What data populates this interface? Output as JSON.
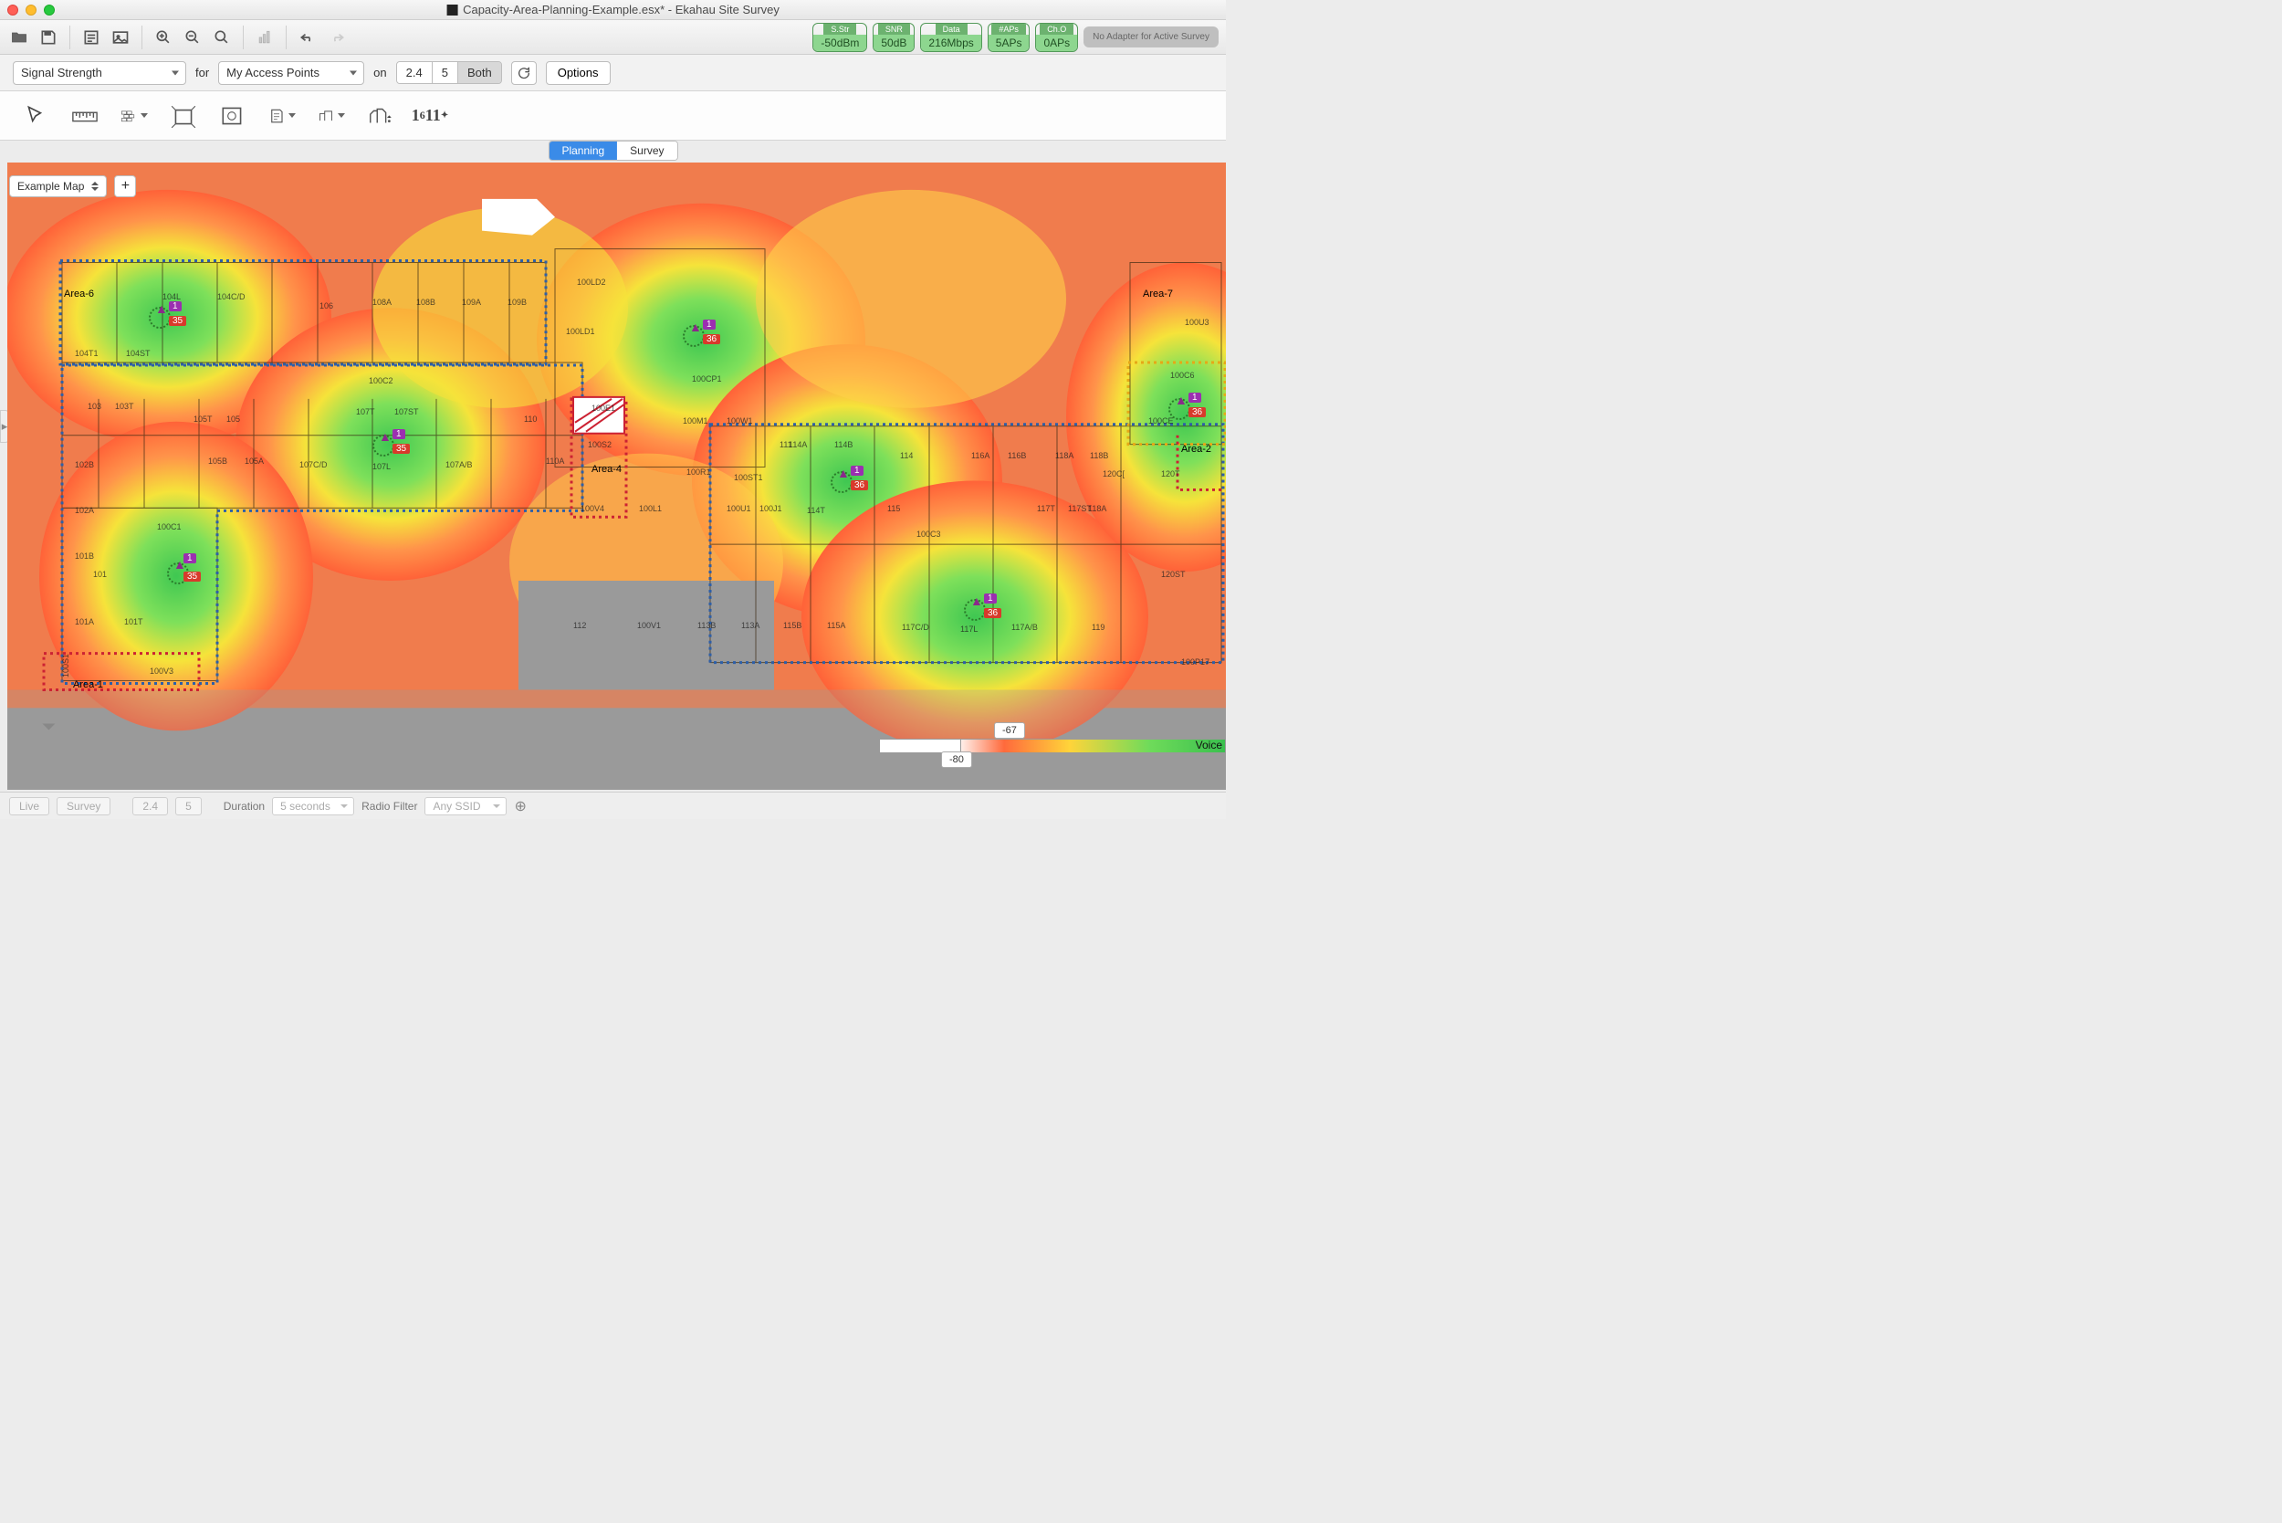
{
  "window": {
    "title": "Capacity-Area-Planning-Example.esx* - Ekahau Site Survey"
  },
  "status": {
    "sstr": {
      "label": "S.Str",
      "value": "-50dBm"
    },
    "snr": {
      "label": "SNR",
      "value": "50dB"
    },
    "data": {
      "label": "Data",
      "value": "216Mbps"
    },
    "aps": {
      "label": "#APs",
      "value": "5APs"
    },
    "cho": {
      "label": "Ch.O",
      "value": "0APs"
    },
    "adapter": "No Adapter for Active Survey"
  },
  "filters": {
    "metric": "Signal Strength",
    "for": "for",
    "scope": "My Access Points",
    "on": "on",
    "band24": "2.4",
    "band5": "5",
    "both": "Both",
    "options": "Options"
  },
  "tabs": {
    "planning": "Planning",
    "survey": "Survey"
  },
  "map": {
    "selector": "Example Map",
    "add": "+"
  },
  "areas": {
    "a1": "Area-1",
    "a2": "Area-2",
    "a4": "Area-4",
    "a6": "Area-6",
    "a7": "Area-7"
  },
  "aps_data": {
    "ch1": "1",
    "ch36": "36",
    "ch35": "35"
  },
  "rooms": {
    "r104L": "104L",
    "r104CD": "104C/D",
    "r106": "106",
    "r108A": "108A",
    "r108B": "108B",
    "r109A": "109A",
    "r109B": "109B",
    "r104ST": "104ST",
    "r104T1": "104T1",
    "r105": "105",
    "r107L": "107L",
    "r107ST": "107ST",
    "r107CD": "107C/D",
    "r107AB": "107A/B",
    "r107T": "107T",
    "r110": "110",
    "r110A": "110A",
    "r100LD1": "100LD1",
    "r100LD2": "100LD2",
    "r100CP1": "100CP1",
    "r100M1": "100M1",
    "r100W1": "100W1",
    "r100R1": "100R1",
    "r100ST1": "100ST1",
    "r100E1": "100E1",
    "r100S2": "100S2",
    "r100V4": "100V4",
    "r100L1": "100L1",
    "r100J1": "100J1",
    "r100U1": "100U1",
    "r111": "111",
    "r112": "112",
    "r113A": "113A",
    "r113B": "113B",
    "r114": "114",
    "r114A": "114A",
    "r114B": "114B",
    "r114T": "114T",
    "r115": "115",
    "r115A": "115A",
    "r115B": "115B",
    "r116A": "116A",
    "r116B": "116B",
    "r117L": "117L",
    "r117AB": "117A/B",
    "r117CD": "117C/D",
    "r117ST": "117ST",
    "r117T": "117T",
    "r118A": "118A",
    "r118B": "118B",
    "r119": "119",
    "r120CD": "120C[",
    "r120ST": "120ST",
    "r120T": "120T",
    "r103": "103",
    "r103T": "103T",
    "r102B": "102B",
    "r102A": "102A",
    "r101": "101",
    "r101A": "101A",
    "r101B": "101B",
    "r101T": "101T",
    "r100C1": "100C1",
    "r100C2": "100C2",
    "r100C3": "100C3",
    "r100V1": "100V1",
    "r100V3": "100V3",
    "r100S1": "100S1",
    "r100P17": "100P17",
    "r100U3": "100U3",
    "r100C6": "100C6",
    "r105A": "105A",
    "r105B": "105B",
    "r105T": "105T",
    "r100CE": "100CE"
  },
  "legend": {
    "top": "-67",
    "bottom": "-80",
    "right": "Voice"
  },
  "bottom": {
    "live": "Live",
    "survey": "Survey",
    "b24": "2.4",
    "b5": "5",
    "duration": "Duration",
    "durval": "5 seconds",
    "radiofilter": "Radio Filter",
    "anyssid": "Any SSID"
  }
}
